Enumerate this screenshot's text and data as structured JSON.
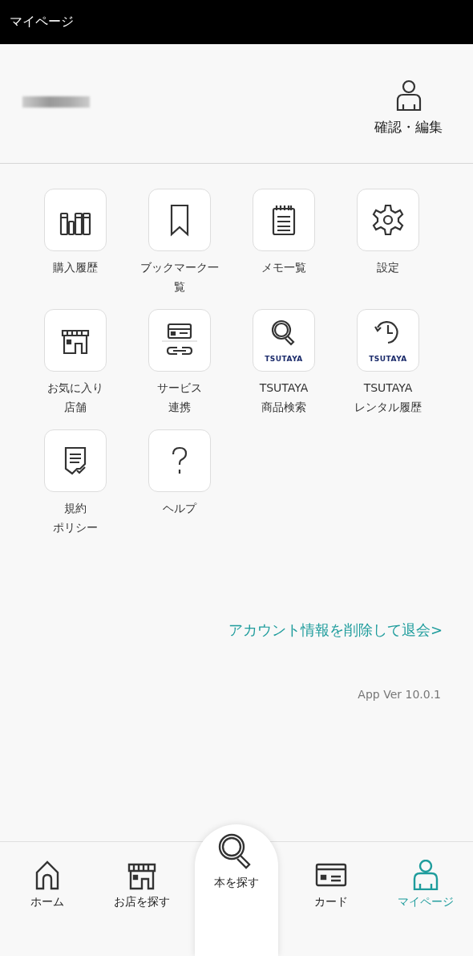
{
  "header": {
    "title": "マイページ"
  },
  "profile": {
    "edit_label": "確認・編集"
  },
  "menu": [
    {
      "kind": "books",
      "lines": [
        "購入履歴"
      ]
    },
    {
      "kind": "bookmark",
      "lines": [
        "ブックマーク一",
        "覧"
      ]
    },
    {
      "kind": "memo",
      "lines": [
        "メモ一覧"
      ]
    },
    {
      "kind": "gear",
      "lines": [
        "設定"
      ]
    },
    {
      "kind": "store",
      "lines": [
        "お気に入り",
        "店舗"
      ]
    },
    {
      "kind": "link",
      "lines": [
        "サービス",
        "連携"
      ]
    },
    {
      "kind": "search",
      "badge": "TSUTAYA",
      "lines": [
        "TSUTAYA",
        "商品検索"
      ]
    },
    {
      "kind": "history",
      "badge": "TSUTAYA",
      "lines": [
        "TSUTAYA",
        "レンタル履歴"
      ]
    },
    {
      "kind": "policy",
      "lines": [
        "規約",
        "ポリシー"
      ]
    },
    {
      "kind": "help",
      "lines": [
        "ヘルプ"
      ]
    }
  ],
  "withdraw_link": "アカウント情報を削除して退会>",
  "version": "App Ver 10.0.1",
  "nav": [
    {
      "kind": "home",
      "label": "ホーム",
      "selected": false,
      "raised": false
    },
    {
      "kind": "store",
      "label": "お店を探す",
      "selected": false,
      "raised": false
    },
    {
      "kind": "search",
      "label": "本を探す",
      "selected": false,
      "raised": true
    },
    {
      "kind": "card",
      "label": "カード",
      "selected": false,
      "raised": false
    },
    {
      "kind": "person",
      "label": "マイページ",
      "selected": true,
      "raised": false
    }
  ]
}
